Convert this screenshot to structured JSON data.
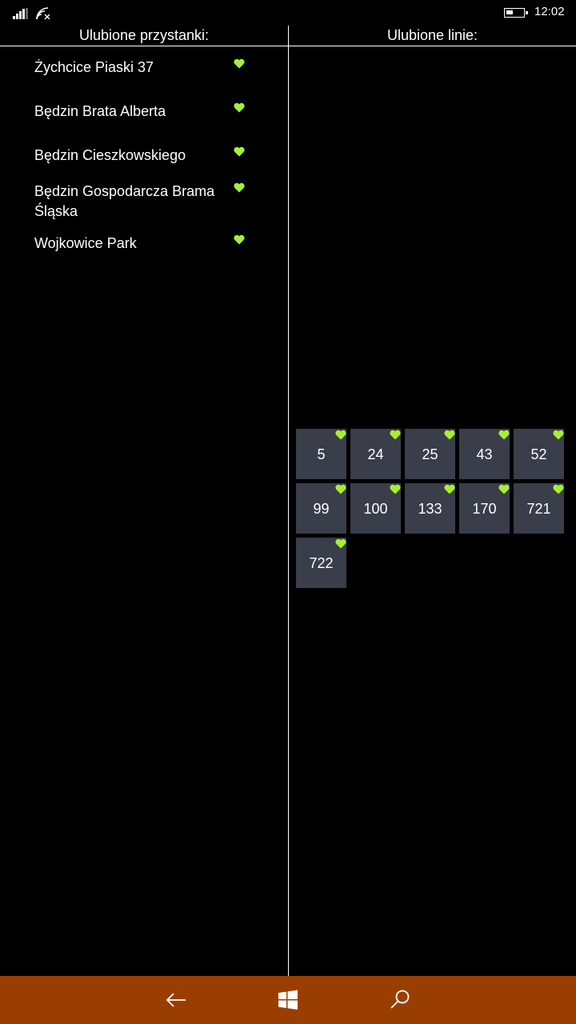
{
  "status_bar": {
    "time": "12:02",
    "icons": [
      "signal-icon",
      "wifi-icon",
      "battery-icon"
    ]
  },
  "stops_panel": {
    "title": "Ulubione przystanki:",
    "items": [
      {
        "name": "Żychcice Piaski 37"
      },
      {
        "name": "Będzin Brata Alberta"
      },
      {
        "name": "Będzin Cieszkowskiego"
      },
      {
        "name": "Będzin Gospodarcza Brama Śląska"
      },
      {
        "name": "Wojkowice Park"
      }
    ]
  },
  "lines_panel": {
    "title": "Ulubione linie:",
    "lines": [
      "5",
      "24",
      "25",
      "43",
      "52",
      "99",
      "100",
      "133",
      "170",
      "721",
      "722"
    ]
  },
  "nav_bar": {
    "buttons": [
      "back-arrow-icon",
      "windows-logo-icon",
      "search-icon"
    ]
  },
  "colors": {
    "heart": "#a6f032",
    "tile": "#3a3d4a",
    "nav_bar": "#9a3e00",
    "background": "#000000"
  }
}
